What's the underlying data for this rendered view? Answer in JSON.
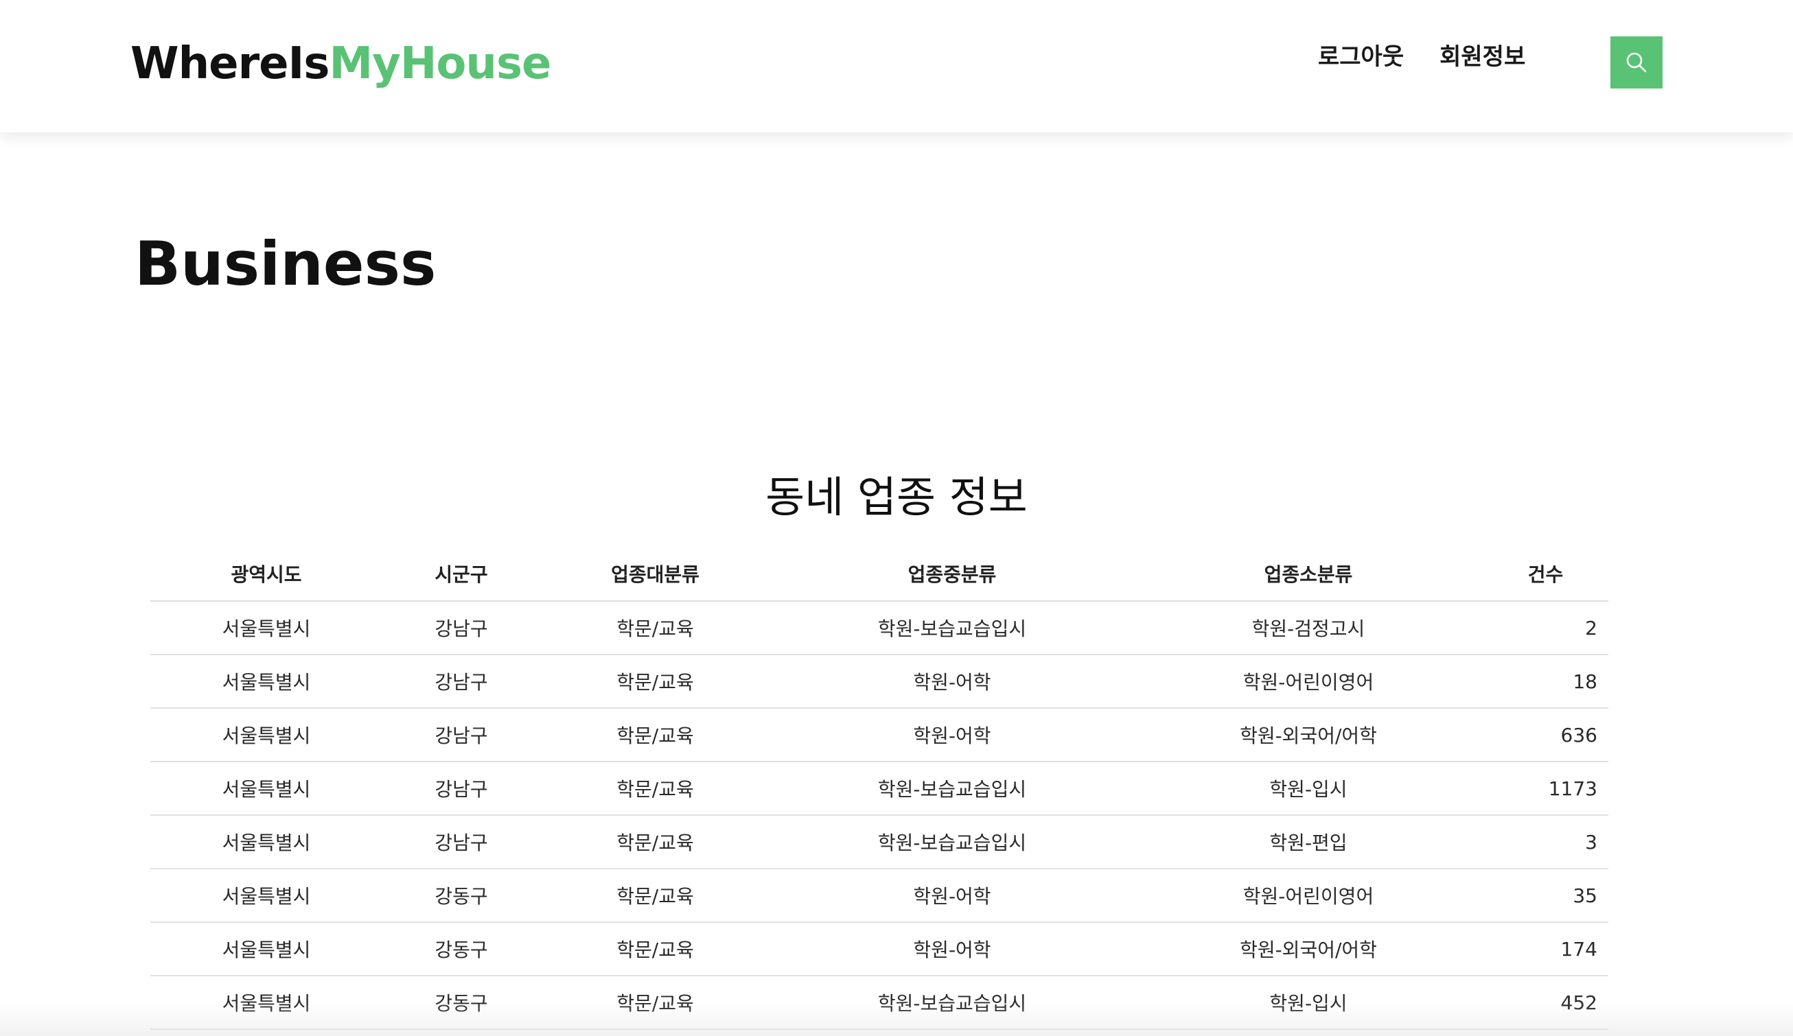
{
  "header": {
    "logo_part1": "WhereIs",
    "logo_part2": "MyHouse",
    "nav": [
      {
        "label": "로그아웃"
      },
      {
        "label": "회원정보"
      }
    ]
  },
  "main": {
    "page_title": "Business",
    "section_title": "동네 업종 정보"
  },
  "table": {
    "columns": [
      "광역시도",
      "시군구",
      "업종대분류",
      "업종중분류",
      "업종소분류",
      "건수"
    ],
    "rows": [
      [
        "서울특별시",
        "강남구",
        "학문/교육",
        "학원-보습교습입시",
        "학원-검정고시",
        "2"
      ],
      [
        "서울특별시",
        "강남구",
        "학문/교육",
        "학원-어학",
        "학원-어린이영어",
        "18"
      ],
      [
        "서울특별시",
        "강남구",
        "학문/교육",
        "학원-어학",
        "학원-외국어/어학",
        "636"
      ],
      [
        "서울특별시",
        "강남구",
        "학문/교육",
        "학원-보습교습입시",
        "학원-입시",
        "1173"
      ],
      [
        "서울특별시",
        "강남구",
        "학문/교육",
        "학원-보습교습입시",
        "학원-편입",
        "3"
      ],
      [
        "서울특별시",
        "강동구",
        "학문/교육",
        "학원-어학",
        "학원-어린이영어",
        "35"
      ],
      [
        "서울특별시",
        "강동구",
        "학문/교육",
        "학원-어학",
        "학원-외국어/어학",
        "174"
      ],
      [
        "서울특별시",
        "강동구",
        "학문/교육",
        "학원-보습교습입시",
        "학원-입시",
        "452"
      ]
    ]
  },
  "colors": {
    "accent": "#5ac275",
    "text": "#111111",
    "row_border": "#e2e2e2"
  },
  "icons": {
    "search": "search-icon"
  }
}
